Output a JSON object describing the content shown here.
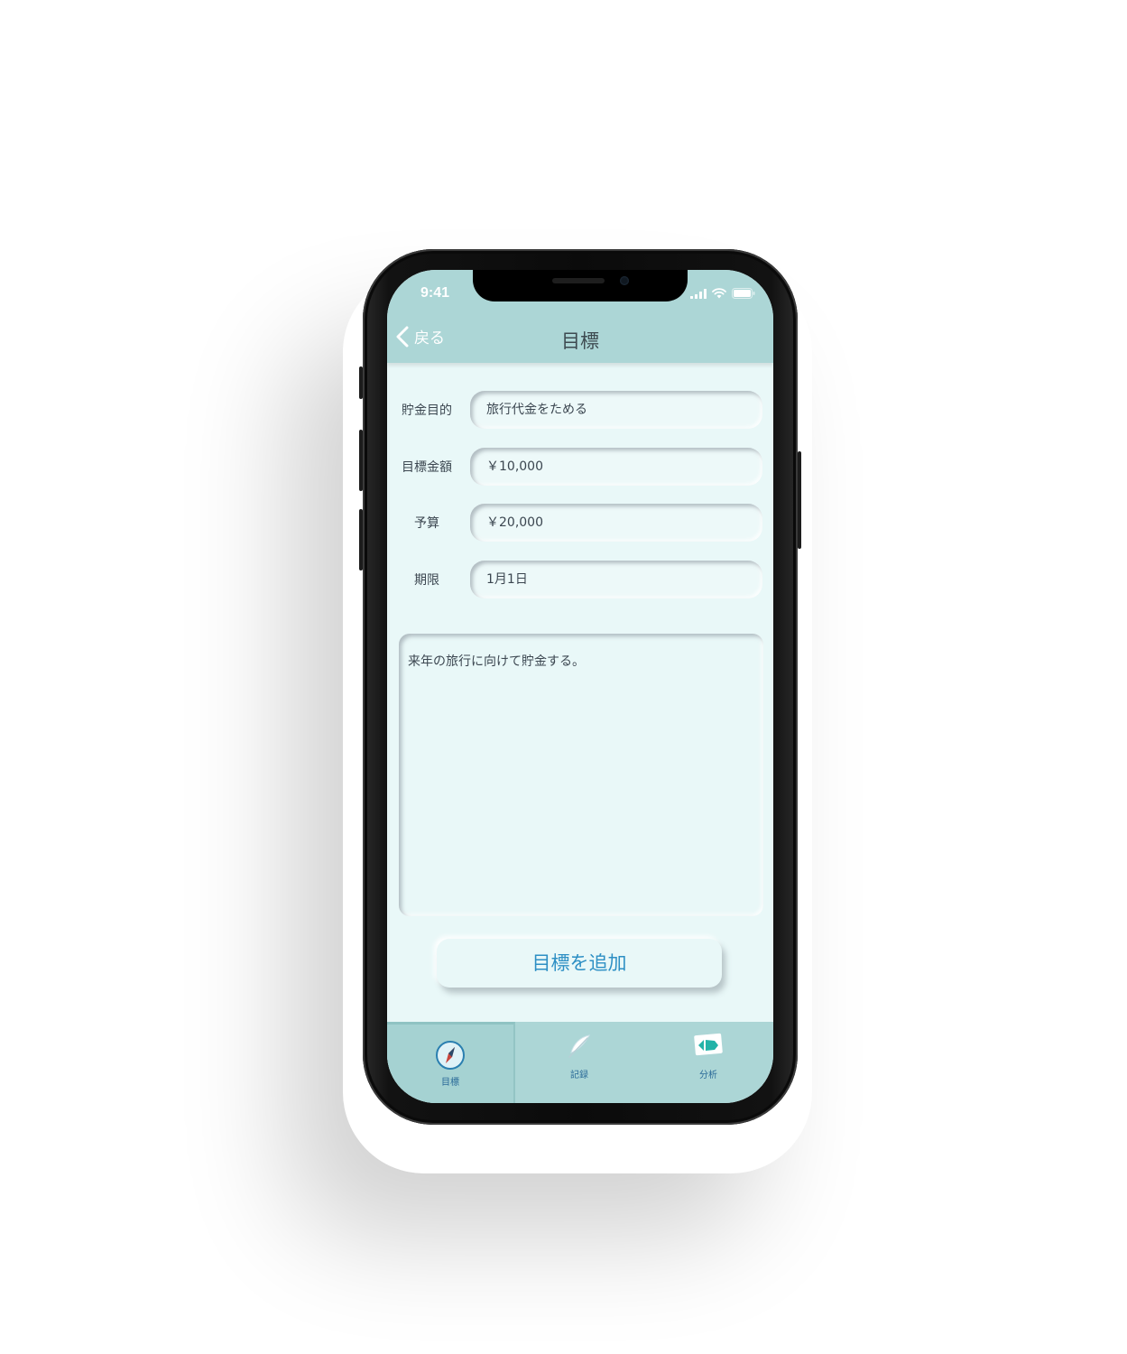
{
  "status_bar": {
    "time": "9:41"
  },
  "header": {
    "back_label": "戻る",
    "title": "目標"
  },
  "form": {
    "fields": [
      {
        "label": "貯金目的",
        "value": "旅行代金をためる"
      },
      {
        "label": "目標金額",
        "value": "￥10,000"
      },
      {
        "label": "予算",
        "value": "￥20,000"
      },
      {
        "label": "期限",
        "value": "1月1日"
      }
    ],
    "memo": "来年の旅行に向けて貯金する。"
  },
  "actions": {
    "add_goal_label": "目標を追加"
  },
  "tabbar": {
    "tabs": [
      {
        "label": "目標",
        "icon": "compass-icon",
        "active": true
      },
      {
        "label": "記録",
        "icon": "feather-icon",
        "active": false
      },
      {
        "label": "分析",
        "icon": "chart-card-icon",
        "active": false
      }
    ]
  },
  "colors": {
    "header_bg": "#acd6d6",
    "screen_bg": "#e9f8f8",
    "accent_blue": "#2d8fc4",
    "text_dark": "#3b4650"
  }
}
